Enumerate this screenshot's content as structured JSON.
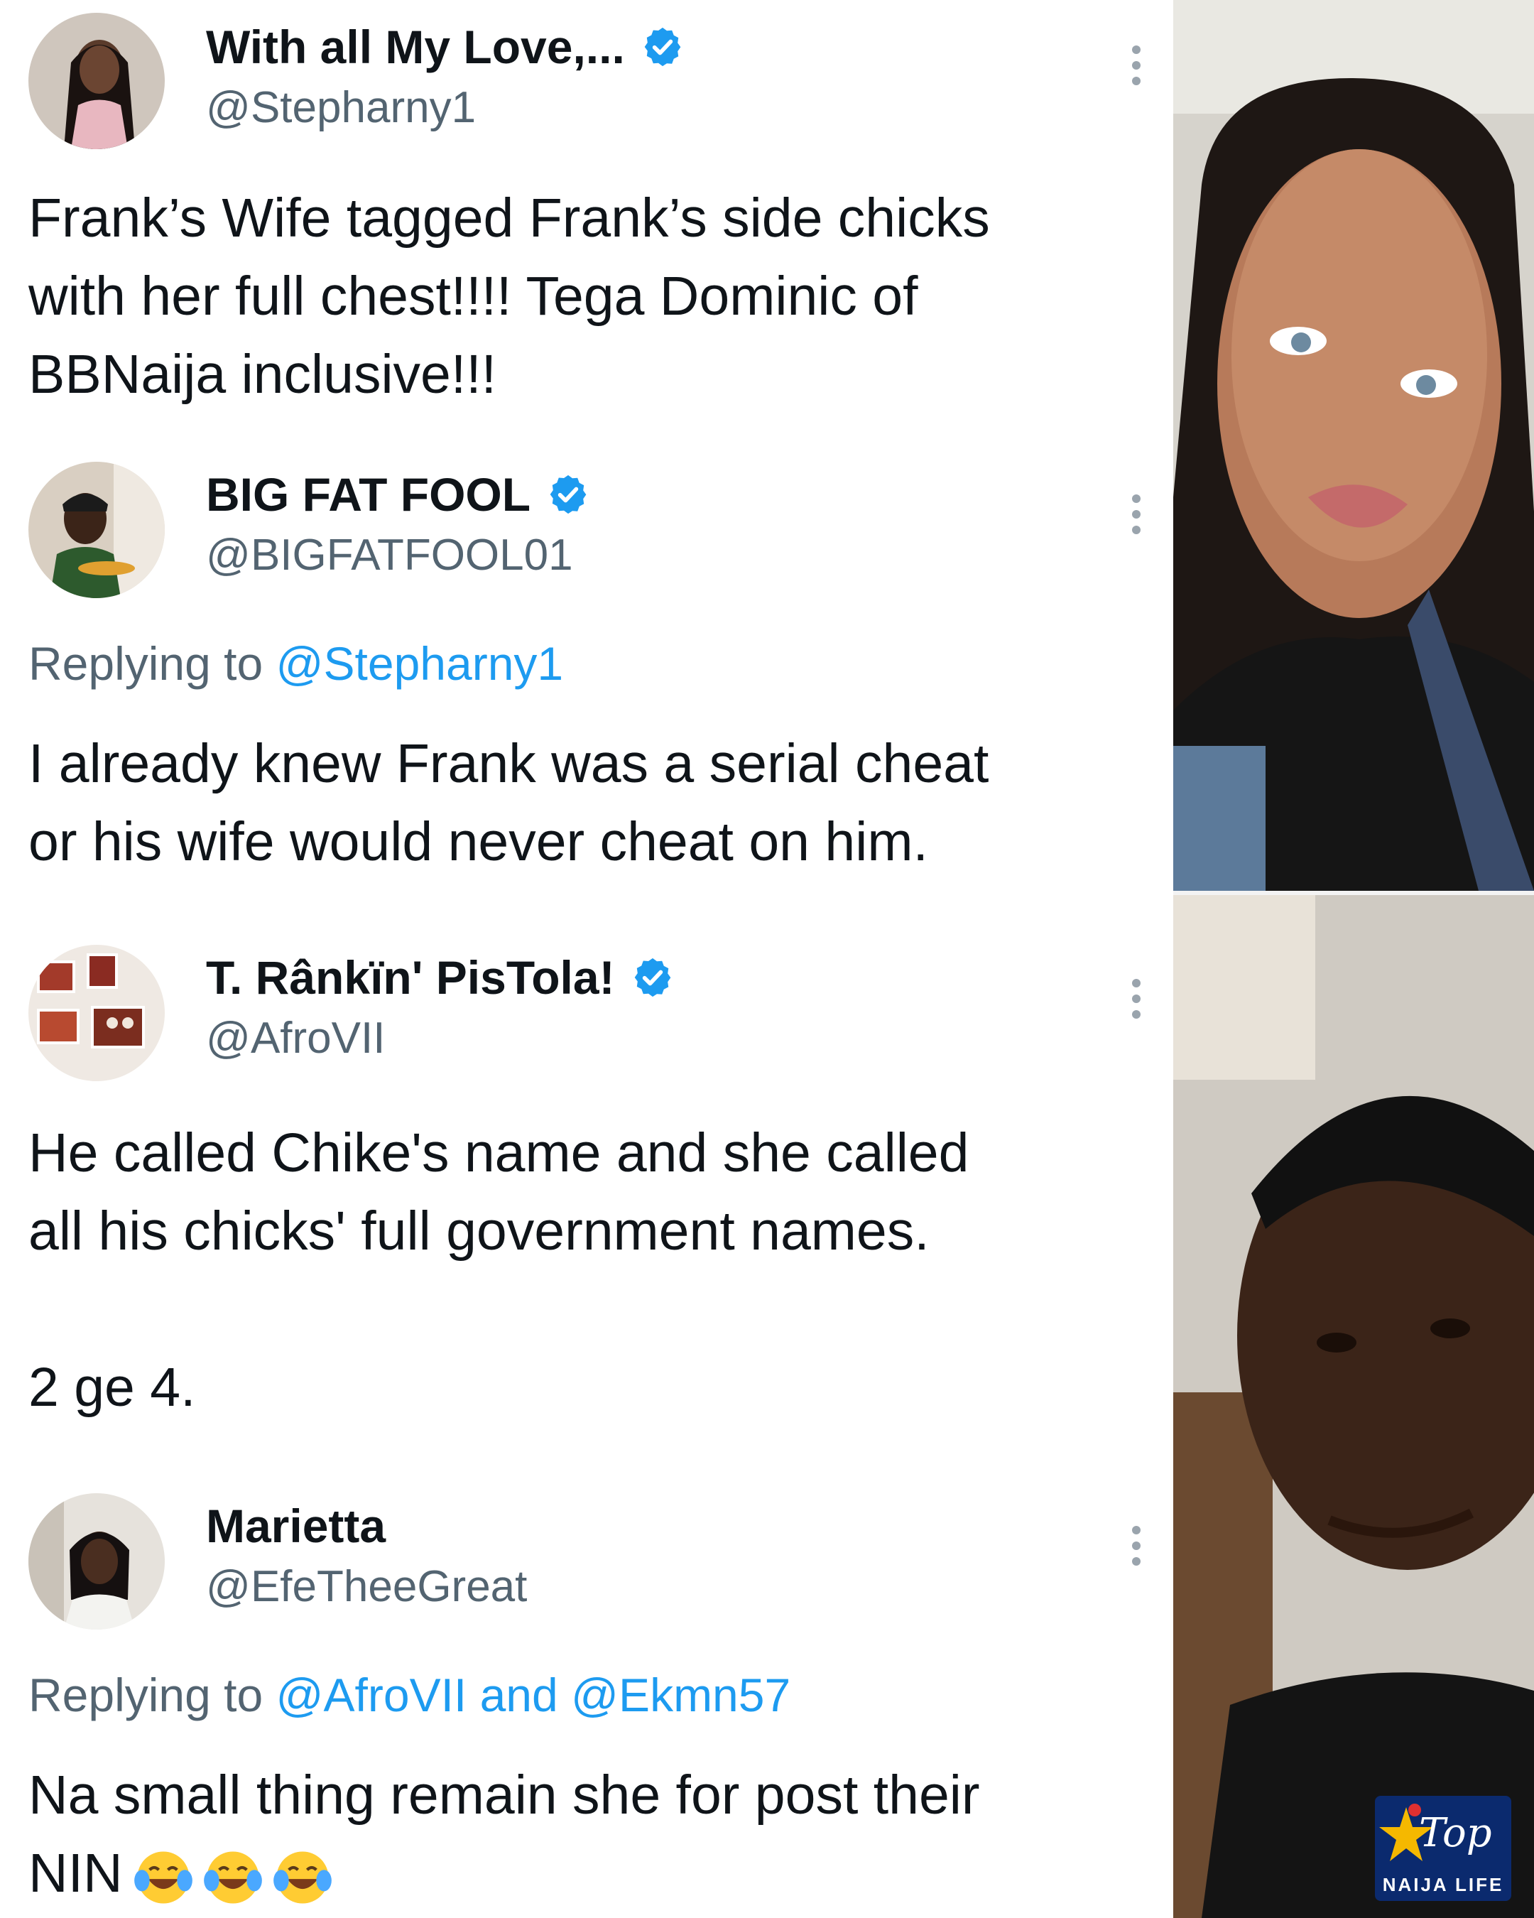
{
  "tweets": [
    {
      "name": "With all My Love,...",
      "handle": "@Stepharny1",
      "verified": true,
      "text": [
        "Frank’s Wife tagged Frank’s side chicks",
        "with her full chest!!!! Tega Dominic of",
        "BBNaija inclusive!!!"
      ]
    },
    {
      "name": "BIG FAT FOOL",
      "handle": "@BIGFATFOOL01",
      "verified": true,
      "replying_prefix": "Replying to ",
      "replying_mentions": "@Stepharny1",
      "text": [
        "I already knew Frank was a serial cheat",
        "or his wife would never cheat on him."
      ]
    },
    {
      "name": "T. Rânkïn' PisTola!",
      "handle": "@AfroVII",
      "verified": true,
      "text": [
        "He called Chike's name and she called",
        "all his chicks' full government names.",
        "2 ge 4."
      ]
    },
    {
      "name": "Marietta",
      "handle": "@EfeTheeGreat",
      "verified": false,
      "replying_prefix": "Replying to ",
      "replying_mentions": "@AfroVII and @Ekmn57",
      "text": [
        "Na small thing remain she for post their",
        "NIN"
      ],
      "emoji": [
        "face-with-tears-of-joy",
        "face-with-tears-of-joy",
        "face-with-tears-of-joy"
      ]
    }
  ],
  "icons": {
    "verified": "verified-badge-icon",
    "more": "more-options-icon"
  },
  "colors": {
    "verified_blue": "#1d9bf0",
    "mention_blue": "#1d9bf0",
    "secondary_text": "#536471"
  },
  "watermark": {
    "top": "Top",
    "bottom": "NAIJA LIFE"
  }
}
